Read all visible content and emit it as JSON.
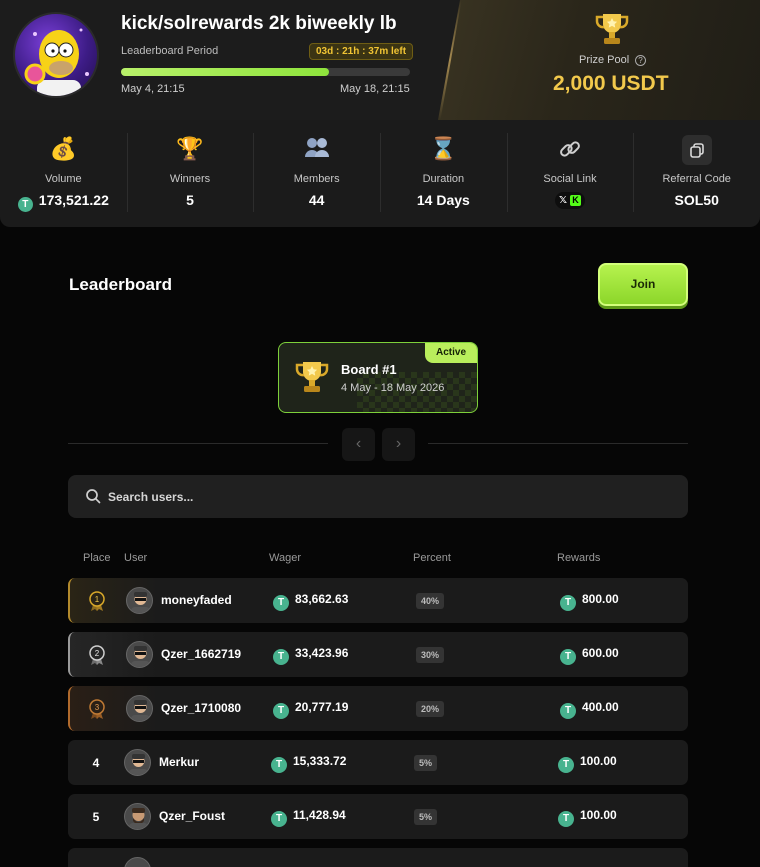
{
  "header": {
    "title": "kick/solrewards 2k biweekly lb",
    "period_label": "Leaderboard Period",
    "time_left": "03d : 21h : 37m left",
    "progress": 0.72,
    "start_date": "May 4, 21:15",
    "end_date": "May 18, 21:15",
    "prize_label": "Prize Pool",
    "prize_value": "2,000 USDT"
  },
  "stats": {
    "volume": {
      "label": "Volume",
      "value": "173,521.22",
      "icon": "money-bag-icon"
    },
    "winners": {
      "label": "Winners",
      "value": "5",
      "icon": "trophy-icon"
    },
    "members": {
      "label": "Members",
      "value": "44",
      "icon": "members-icon"
    },
    "duration": {
      "label": "Duration",
      "value": "14 Days",
      "icon": "hourglass-icon"
    },
    "social": {
      "label": "Social Link",
      "icon": "link-icon"
    },
    "referral": {
      "label": "Referral Code",
      "value": "SOL50",
      "icon": "copy-icon"
    }
  },
  "leaderboard": {
    "title": "Leaderboard",
    "join_label": "Join",
    "board": {
      "name": "Board #1",
      "dates": "4 May - 18 May 2026",
      "status": "Active"
    },
    "search_placeholder": "Search users...",
    "columns": {
      "place": "Place",
      "user": "User",
      "wager": "Wager",
      "percent": "Percent",
      "rewards": "Rewards"
    },
    "rows": [
      {
        "place": "1",
        "user": "moneyfaded",
        "wager": "83,662.63",
        "percent": "40%",
        "reward": "800.00"
      },
      {
        "place": "2",
        "user": "Qzer_1662719",
        "wager": "33,423.96",
        "percent": "30%",
        "reward": "600.00"
      },
      {
        "place": "3",
        "user": "Qzer_1710080",
        "wager": "20,777.19",
        "percent": "20%",
        "reward": "400.00"
      },
      {
        "place": "4",
        "user": "Merkur",
        "wager": "15,333.72",
        "percent": "5%",
        "reward": "100.00"
      },
      {
        "place": "5",
        "user": "Qzer_Foust",
        "wager": "11,428.94",
        "percent": "5%",
        "reward": "100.00"
      }
    ]
  },
  "colors": {
    "accent_green": "#b9ee5c",
    "gold": "#f2c94c",
    "tether": "#48b38f"
  }
}
